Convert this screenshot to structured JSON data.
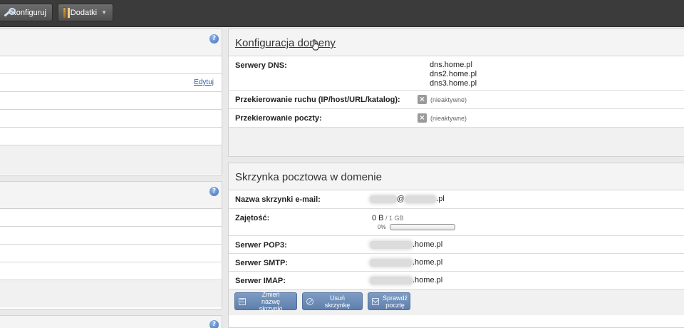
{
  "toolbar": {
    "configure_label": "Konfiguruj",
    "addons_label": "Dodatki"
  },
  "left": {
    "help": "?",
    "edit_label": "Edytuj"
  },
  "domain_config": {
    "title": "Konfiguracja domeny",
    "dns_label": "Serwery DNS:",
    "dns_servers": [
      "dns.home.pl",
      "dns2.home.pl",
      "dns3.home.pl"
    ],
    "traffic_label": "Przekierowanie ruchu (IP/host/URL/katalog):",
    "traffic_status": "(nieaktywne)",
    "mail_redirect_label": "Przekierowanie poczty:",
    "mail_redirect_status": "(nieaktywne)"
  },
  "mailbox": {
    "title": "Skrzynka pocztowa w domenie",
    "name_label": "Nazwa skrzynki e-mail:",
    "name_at": "@",
    "name_suffix": ".pl",
    "usage_label": "Zajętość:",
    "usage_used": "0 B",
    "usage_sep": " / ",
    "usage_total": "1 GB",
    "usage_percent_text": "0%",
    "usage_fraction": 0,
    "pop3_label": "Serwer POP3:",
    "pop3_suffix": ".home.pl",
    "smtp_label": "Serwer SMTP:",
    "smtp_suffix": ".home.pl",
    "imap_label": "Serwer IMAP:",
    "imap_suffix": ".home.pl",
    "rename_label_line1": "Zmień",
    "rename_label_line2": "nazwę skrzynki",
    "delete_label": "Usuń skrzynkę",
    "check_label_line1": "Sprawdź",
    "check_label_line2": "pocztę"
  },
  "colors": {
    "toolbar_bg": "#3b3b3b",
    "link": "#2b5aa8",
    "action_button": "#6f8fbb"
  },
  "icons": [
    "wrench-icon",
    "box-icon",
    "help-icon",
    "inactive-x-icon",
    "rename-icon",
    "delete-icon",
    "mail-icon",
    "cursor-icon"
  ]
}
